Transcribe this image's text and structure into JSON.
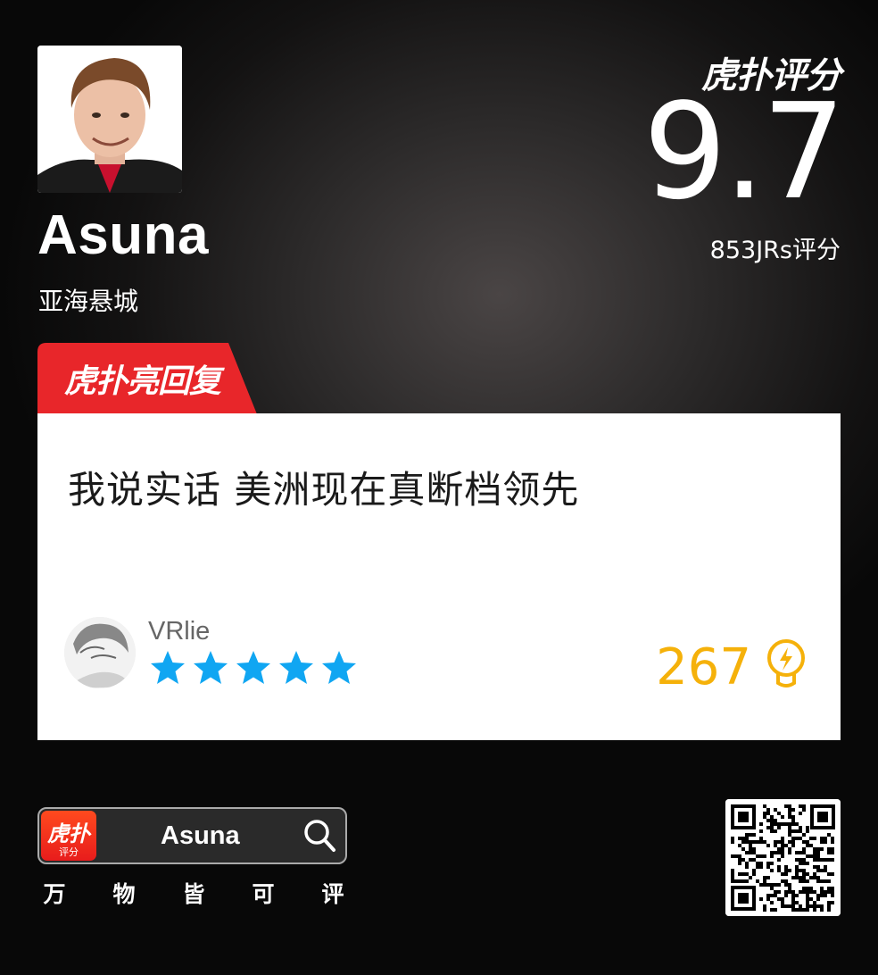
{
  "player": {
    "name": "Asuna",
    "team": "亚海悬城"
  },
  "rating": {
    "brand": "虎扑评分",
    "score": "9.7",
    "count": "853JRs评分"
  },
  "banner": {
    "label": "虎扑亮回复"
  },
  "comment": {
    "text": "我说实话 美洲现在真断档领先",
    "username": "VRlie",
    "stars": 5,
    "likes": "267"
  },
  "footer": {
    "app_icon_label": "虎扑",
    "app_icon_sub": "评分",
    "search_text": "Asuna",
    "slogan": [
      "万",
      "物",
      "皆",
      "可",
      "评"
    ]
  },
  "colors": {
    "accent_red": "#e8262a",
    "star_blue": "#10a6f2",
    "likes_gold": "#f5b10a"
  },
  "icons": {
    "search": "search-icon",
    "likes": "lightbulb-icon",
    "qr": "qr-code"
  }
}
